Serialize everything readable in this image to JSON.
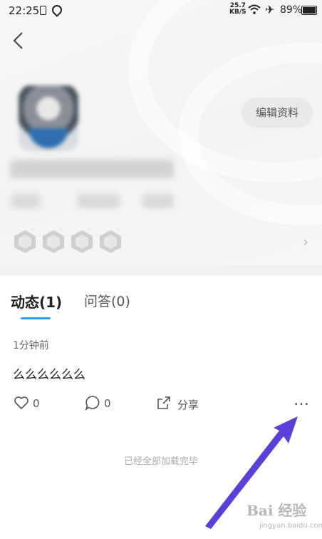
{
  "status_bar": {
    "time": "22:25",
    "net_speed_value": "25.7",
    "net_speed_unit": "KB/S",
    "battery": "89%"
  },
  "profile": {
    "edit_button": "编辑资料"
  },
  "tabs": [
    {
      "label": "动态(1)",
      "active": true
    },
    {
      "label": "问答(0)",
      "active": false
    }
  ],
  "post": {
    "time": "1分钟前",
    "content": "么么么么么么",
    "likes": "0",
    "comments": "0",
    "share_label": "分享",
    "more_icon": "…"
  },
  "footer_text": "已经全部加载完毕",
  "watermark": {
    "main": "Bai 经验",
    "sub": "jingyan.baidu.com"
  },
  "colors": {
    "tab_underline": "#2e9bf0",
    "annotation_arrow": "#5b3fd8"
  }
}
